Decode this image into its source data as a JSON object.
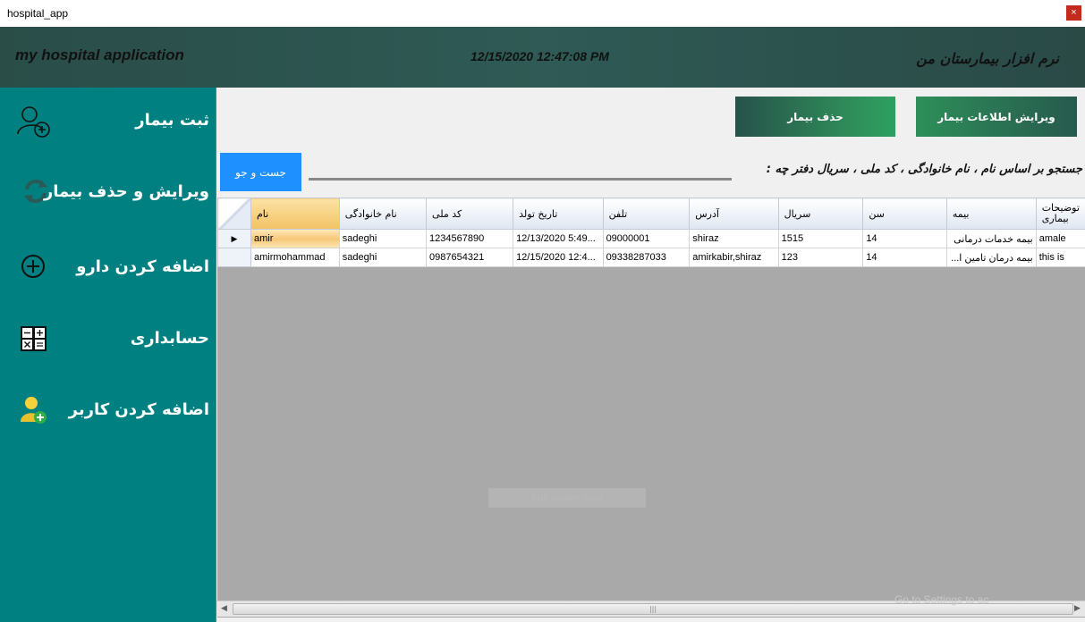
{
  "window": {
    "title": "hospital_app",
    "close_label": "×"
  },
  "header": {
    "app_title": "my hospital application",
    "clock": "12/15/2020 12:47:08 PM",
    "app_title_fa": "نرم افزار بیمارستان من"
  },
  "sidebar": {
    "items": [
      {
        "label": "ثبت بیمار",
        "icon": "add-person-icon"
      },
      {
        "label": "ویرایش و حذف بیمار",
        "icon": "refresh-icon"
      },
      {
        "label": "اضافه کردن دارو",
        "icon": "plus-circle-icon"
      },
      {
        "label": "حسابداری",
        "icon": "calculator-icon"
      },
      {
        "label": "اضافه کردن کاربر",
        "icon": "add-user-icon"
      }
    ]
  },
  "toolbar": {
    "delete_label": "حذف بیمار",
    "edit_label": "ویرایش اطلاعات بیمار"
  },
  "search": {
    "button_label": "جست و جو",
    "value": "",
    "label": "جستجو بر اساس نام ، نام خانوادگی ، کد ملی ، سریال دفتر چه :"
  },
  "grid": {
    "columns": [
      "نام",
      "نام خانوادگی",
      "کد ملی",
      "تاریخ تولد",
      "تلفن",
      "آدرس",
      "سریال",
      "سن",
      "بیمه",
      "توضیحات بیماری"
    ],
    "rows": [
      [
        "amir",
        "sadeghi",
        "1234567890",
        "12/13/2020 5:49...",
        "09000001",
        "shiraz",
        "1515",
        "14",
        "بیمه خدمات درمانی",
        "amale"
      ],
      [
        "amirmohammad",
        "sadeghi",
        "0987654321",
        "12/15/2020 12:4...",
        "09338287033",
        "amirkabir,shiraz",
        "123",
        "14",
        "بیمه درمان تامین ا...",
        "this is"
      ]
    ],
    "current_row_marker": "▶"
  },
  "overlay": {
    "watermark": "Full-screen Snip"
  },
  "system": {
    "activate_text": "Go to Settings to ac"
  },
  "colors": {
    "sidebar": "#008080",
    "header": "#2f5a55",
    "search_button": "#1e90ff",
    "action_button": "#2e8b57"
  }
}
